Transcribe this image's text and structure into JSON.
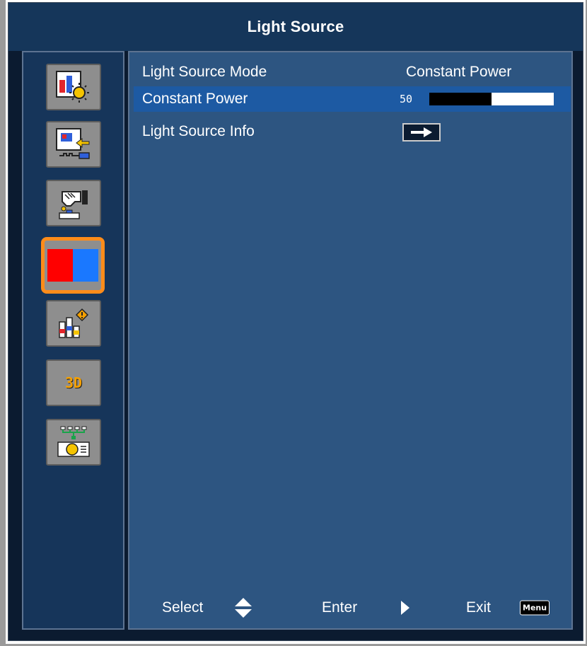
{
  "window": {
    "title": "Light Source"
  },
  "sidebar": {
    "items": [
      {
        "icon": "display-settings-icon",
        "active": false
      },
      {
        "icon": "input-source-icon",
        "active": false
      },
      {
        "icon": "setup-hand-icon",
        "active": false
      },
      {
        "icon": "light-source-color-icon",
        "active": true
      },
      {
        "icon": "information-chart-icon",
        "active": false
      },
      {
        "icon": "3d-icon",
        "label": "3D",
        "active": false
      },
      {
        "icon": "network-projector-icon",
        "active": false
      }
    ]
  },
  "menu": {
    "rows": [
      {
        "label": "Light Source Mode",
        "value": "Constant Power"
      },
      {
        "label": "Constant Power",
        "value": "50",
        "level": 0.5,
        "selected": true
      },
      {
        "label": "Light Source Info",
        "control": "enter-arrow-icon"
      }
    ]
  },
  "footer": {
    "select_label": "Select",
    "enter_label": "Enter",
    "exit_label": "Exit",
    "menu_key": "Menu"
  },
  "colors": {
    "title_bar": "#15365a",
    "content_bg": "#2d5581",
    "selected_row": "#1d5aa3",
    "active_border": "#ff8c1a"
  }
}
